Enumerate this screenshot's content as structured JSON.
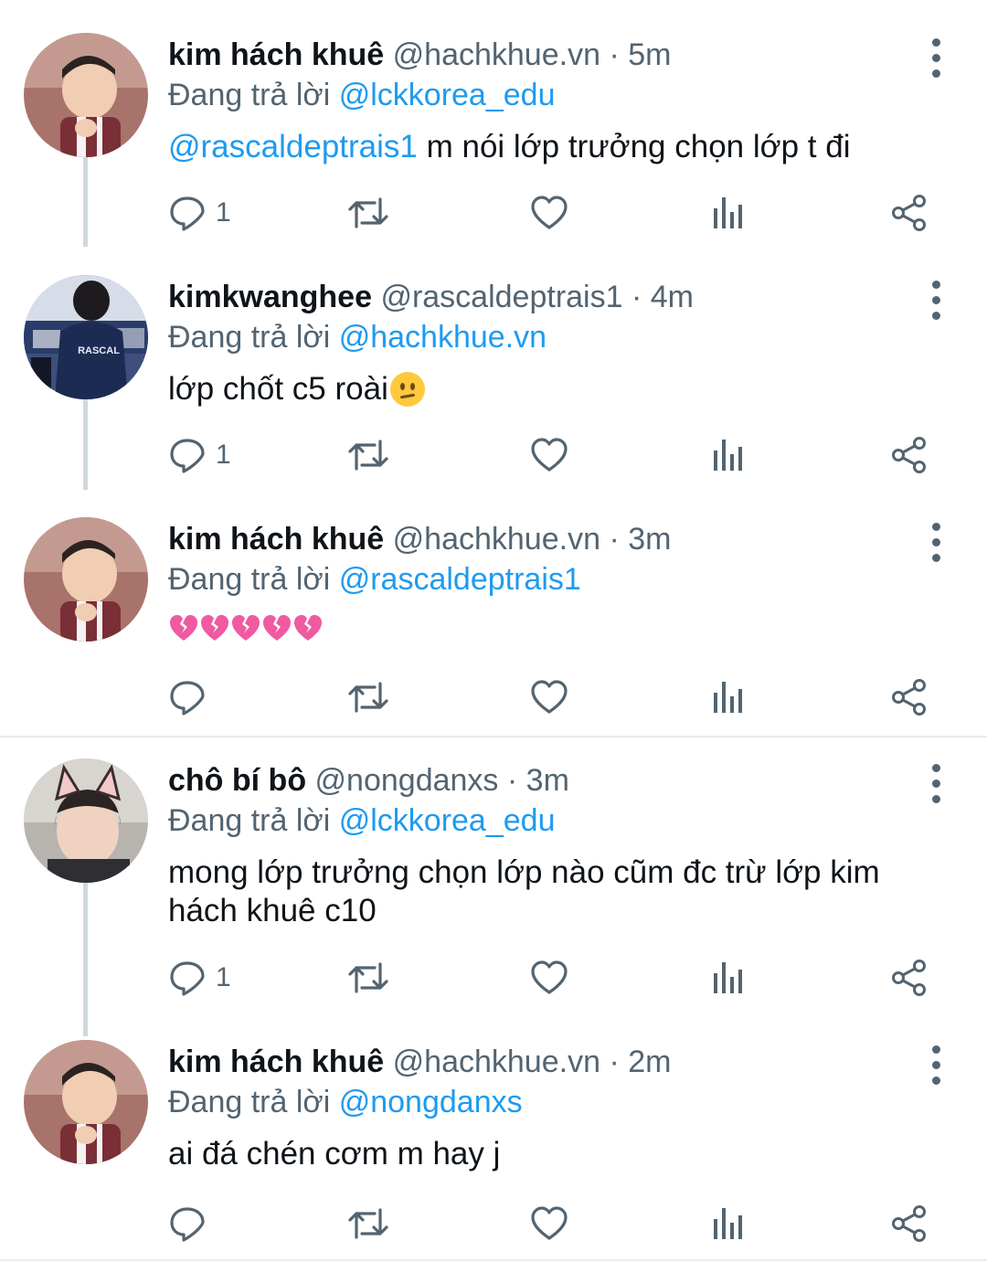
{
  "reply_prefix": "Đang trả lời",
  "tweets": [
    {
      "name": "kim hách khuê",
      "handle": "@hachkhue.vn",
      "sep": "·",
      "time": "5m",
      "replying_to": "@lckkorea_edu",
      "mention": "@rascaldeptrais1",
      "text": " m nói lớp trưởng chọn lớp t đi",
      "reply_count": "1",
      "avatar": "baby-avatar"
    },
    {
      "name": "kimkwanghee",
      "handle": "@rascaldeptrais1",
      "sep": "·",
      "time": "4m",
      "replying_to": "@hachkhue.vn",
      "text": "lớp chốt c5 roài",
      "emoji": "slightly-frowning-face",
      "reply_count": "1",
      "avatar": "jacket-avatar",
      "avatar_text": "RASCAL"
    },
    {
      "name": "kim hách khuê",
      "handle": "@hachkhue.vn",
      "sep": "·",
      "time": "3m",
      "replying_to": "@rascaldeptrais1",
      "emoji": "broken-heart x5",
      "emoji_color": "#f05aa0",
      "reply_count": "",
      "avatar": "baby-avatar"
    },
    {
      "name": "chô bí bô",
      "handle": "@nongdanxs",
      "sep": "·",
      "time": "3m",
      "replying_to": "@lckkorea_edu",
      "text_line1": "mong lớp trưởng chọn lớp nào cũm đc trừ lớp kim",
      "text_line2": "hách khuê c10",
      "reply_count": "1",
      "avatar": "cat-ears-avatar"
    },
    {
      "name": "kim hách khuê",
      "handle": "@hachkhue.vn",
      "sep": "·",
      "time": "2m",
      "replying_to": "@nongdanxs",
      "text": "ai đá chén cơm m hay j",
      "reply_count": "",
      "avatar": "baby-avatar"
    }
  ],
  "colors": {
    "link": "#1d9bf0",
    "muted": "#536471",
    "text": "#0f1419",
    "thread": "#cfd9de"
  },
  "icons": [
    "reply-icon",
    "retweet-icon",
    "like-icon",
    "analytics-icon",
    "share-icon",
    "more-icon"
  ]
}
